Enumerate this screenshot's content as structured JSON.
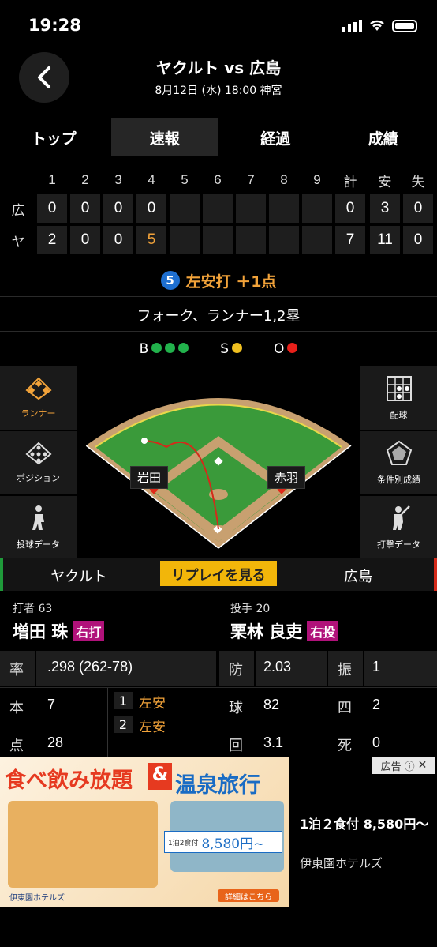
{
  "status": {
    "time": "19:28"
  },
  "header": {
    "title": "ヤクルト vs 広島",
    "subtitle": "8月12日 (水) 18:00 神宮"
  },
  "tabs": [
    "トップ",
    "速報",
    "経過",
    "成績"
  ],
  "scoreboard": {
    "headers": [
      "1",
      "2",
      "3",
      "4",
      "5",
      "6",
      "7",
      "8",
      "9",
      "計",
      "安",
      "失"
    ],
    "rows": [
      {
        "team": "広",
        "innings": [
          "0",
          "0",
          "0",
          "0",
          "",
          "",
          "",
          "",
          "",
          ""
        ],
        "totals": [
          "0",
          "3",
          "0"
        ]
      },
      {
        "team": "ヤ",
        "innings": [
          "2",
          "0",
          "0",
          "5",
          "",
          "",
          "",
          "",
          "",
          ""
        ],
        "totals": [
          "7",
          "11",
          "0"
        ]
      }
    ]
  },
  "play": {
    "order": "5",
    "result": "左安打 ＋1点"
  },
  "pitch": {
    "description": "フォーク、ランナー1,2塁"
  },
  "count": {
    "b": "B",
    "s": "S",
    "o": "O"
  },
  "left_menu": [
    "ランナー",
    "ポジション",
    "投球データ"
  ],
  "right_menu": [
    "配球",
    "条件別成績",
    "打撃データ"
  ],
  "runners": {
    "first": "赤羽",
    "second": "岩田"
  },
  "teams": {
    "home": "ヤクルト",
    "away": "広島",
    "replay": "リプレイを見る"
  },
  "batter": {
    "label": "打者 63",
    "name": "増田 珠",
    "hand": "右打",
    "avg_label": "率",
    "avg": ".298 (262-78)",
    "hr_label": "本",
    "hr": "7",
    "rbi_label": "点",
    "rbi": "28",
    "atbats": [
      {
        "n": "1",
        "r": "左安"
      },
      {
        "n": "2",
        "r": "左安"
      }
    ]
  },
  "pitcher": {
    "label": "投手 20",
    "name": "栗林 良吏",
    "hand": "右投",
    "era_label": "防",
    "era": "2.03",
    "k_label": "振",
    "k": "1",
    "np_label": "球",
    "np": "82",
    "bb_label": "四",
    "bb": "2",
    "ip_label": "回",
    "ip": "3.1",
    "hbp_label": "死",
    "hbp": "0"
  },
  "ad": {
    "label": "広告",
    "headline1": "食べ飲み放題",
    "amp": "&",
    "headline2": "温泉旅行",
    "brand": "伊東園ホテルズ",
    "price_small": "1泊2食付",
    "price": "8,580円~",
    "cta": "詳細はこちら",
    "text_price": "1泊２食付 8,580円〜",
    "text_brand": "伊東園ホテルズ"
  }
}
